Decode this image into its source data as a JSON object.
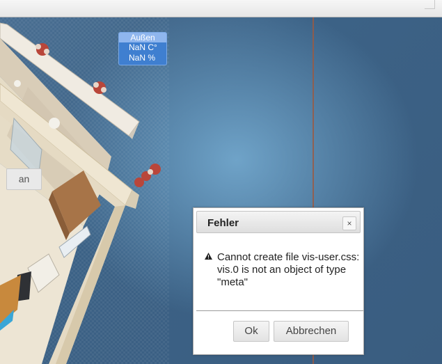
{
  "widget": {
    "header": "Außen",
    "temperature": "NaN C°",
    "humidity": "NaN %"
  },
  "switch_button": {
    "label": "an"
  },
  "dialog": {
    "title": "Fehler",
    "close_glyph": "×",
    "message_lines": [
      "Cannot create file vis-user.css:",
      "vis.0 is not an object of type",
      "\"meta\""
    ],
    "ok_label": "Ok",
    "cancel_label": "Abbrechen"
  },
  "icons": {
    "warning": "warning-icon",
    "close": "close-icon"
  }
}
